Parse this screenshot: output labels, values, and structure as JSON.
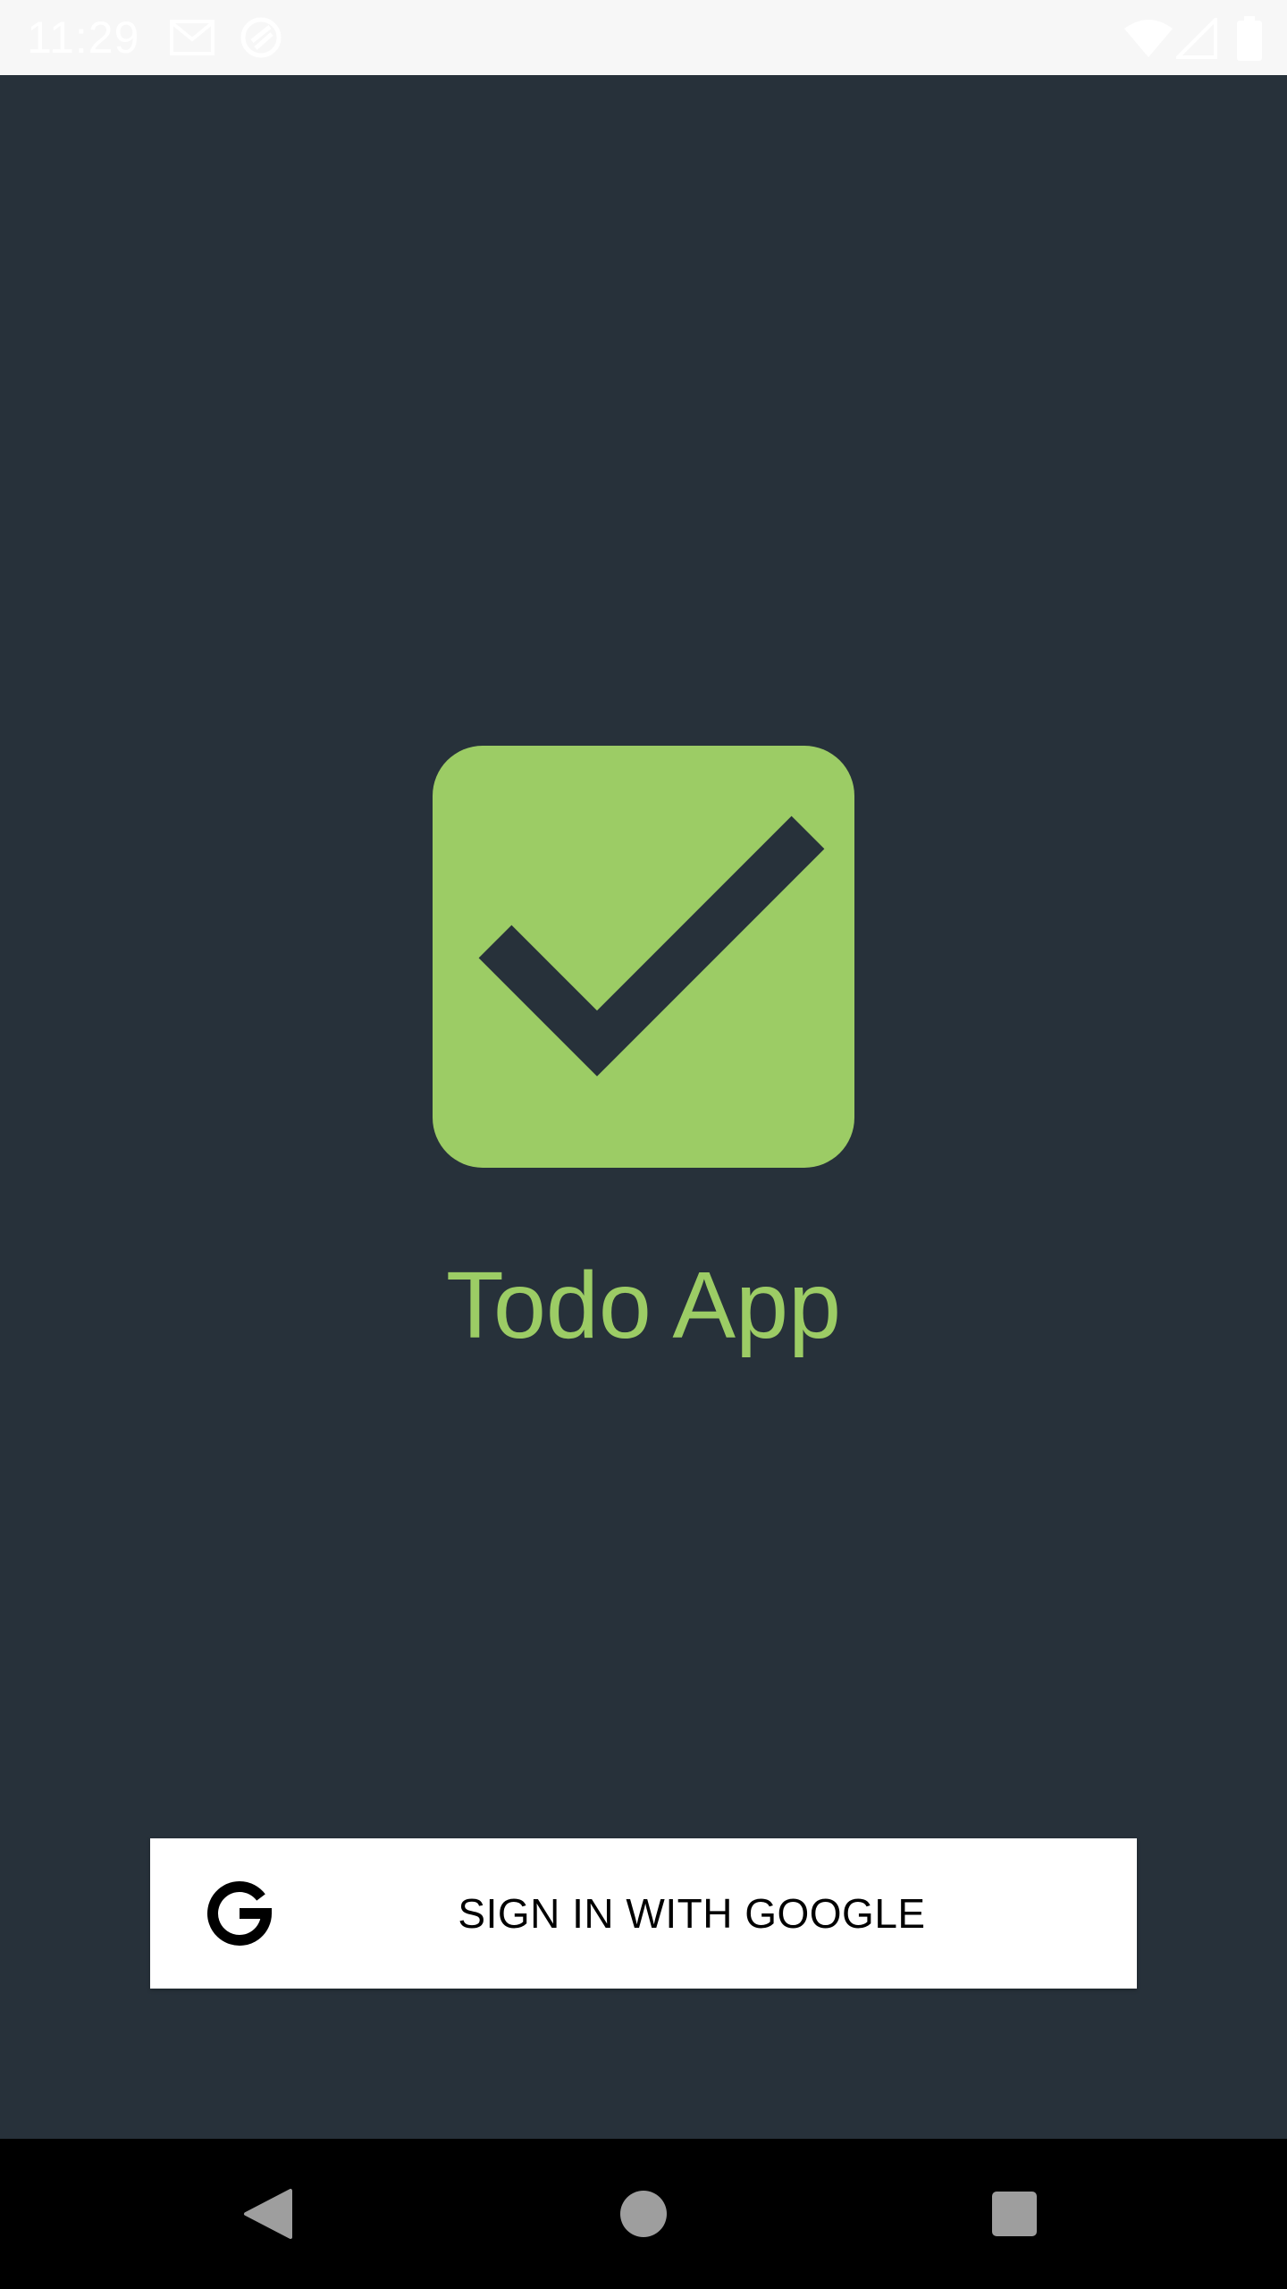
{
  "status_bar": {
    "time": "11:29",
    "icons": [
      "gmail-icon",
      "sync-icon",
      "wifi-icon",
      "signal-icon",
      "battery-icon"
    ]
  },
  "app": {
    "logo_icon": "check-box-icon",
    "title": "Todo App"
  },
  "signin": {
    "icon": "google-g-icon",
    "label": "SIGN IN WITH GOOGLE"
  },
  "nav_bar": {
    "buttons": [
      "back-icon",
      "home-icon",
      "recents-icon"
    ]
  },
  "colors": {
    "background": "#27313a",
    "accent": "#9ccc65",
    "status_bar": "#f7f7f7",
    "nav_bar": "#000000",
    "button_bg": "#ffffff"
  }
}
